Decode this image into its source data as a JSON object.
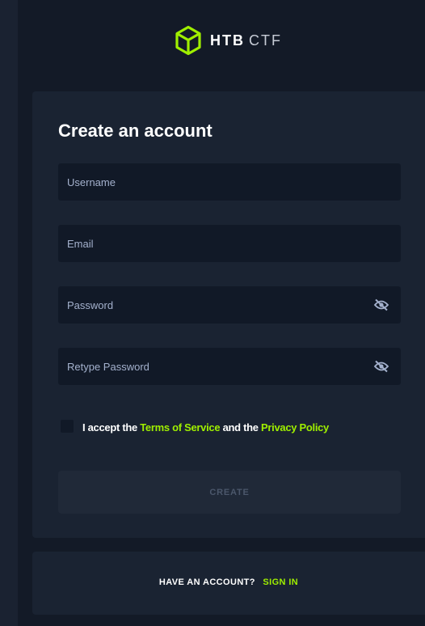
{
  "brand": {
    "name_strong": "HTB",
    "name_light": "CTF",
    "accent_color": "#9fef00",
    "icon": "cube-logo-icon"
  },
  "form": {
    "title": "Create an account",
    "fields": {
      "username": {
        "placeholder": "Username",
        "value": ""
      },
      "email": {
        "placeholder": "Email",
        "value": ""
      },
      "password": {
        "placeholder": "Password",
        "value": "",
        "toggle_icon": "eye-slash-icon"
      },
      "retype_password": {
        "placeholder": "Retype Password",
        "value": "",
        "toggle_icon": "eye-slash-icon"
      }
    },
    "terms": {
      "checked": false,
      "prefix": "I accept the",
      "terms_link": "Terms of Service",
      "middle": "and the",
      "privacy_link": "Privacy Policy"
    },
    "submit_label": "CREATE"
  },
  "footer": {
    "question": "HAVE AN ACCOUNT?",
    "signin_label": "SIGN IN"
  }
}
